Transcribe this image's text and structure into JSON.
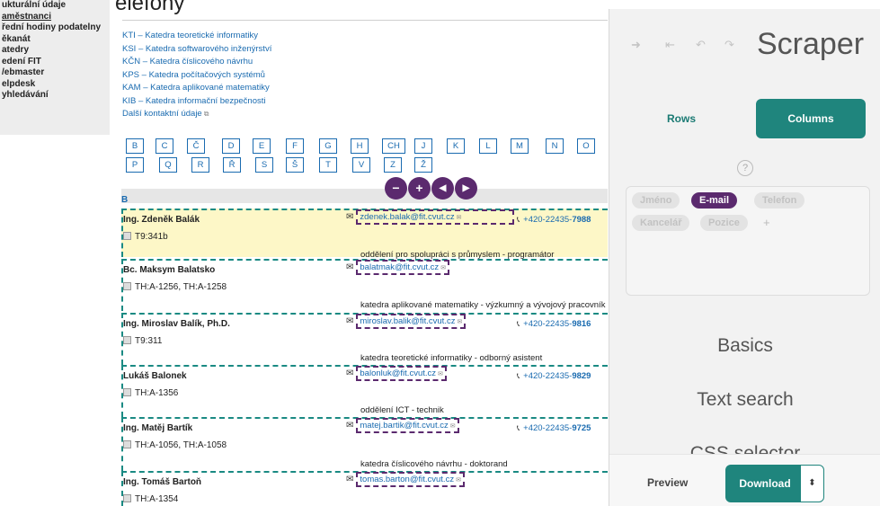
{
  "nav": {
    "items": [
      {
        "label": "ukturální údaje",
        "active": false
      },
      {
        "label": "aměstnanci",
        "active": true
      },
      {
        "label": "řední hodiny podatelny",
        "active": false
      },
      {
        "label": "ěkanát",
        "active": false
      },
      {
        "label": "atedry",
        "active": false
      },
      {
        "label": "edení FIT",
        "active": false
      },
      {
        "label": "/ebmaster",
        "active": false
      },
      {
        "label": "elpdesk",
        "active": false
      },
      {
        "label": "yhledávání",
        "active": false
      }
    ]
  },
  "page": {
    "title": "elefony"
  },
  "departments": [
    "KTI – Katedra teoretické informatiky",
    "KSI – Katedra softwarového inženýrství",
    "KČN – Katedra číslicového návrhu",
    "KPS – Katedra počítačových systémů",
    "KAM – Katedra aplikované matematiky",
    "KIB – Katedra informační bezpečnosti",
    "Další kontaktní údaje"
  ],
  "letters": {
    "row1": [
      "B",
      "C",
      "Č",
      "D",
      "E",
      "F",
      "G",
      "H",
      "CH",
      "J",
      "K",
      "L",
      "M",
      "N",
      "O"
    ],
    "row2": [
      "P",
      "Q",
      "R",
      "Ř",
      "S",
      "Š",
      "T",
      "V",
      "Z",
      "Ž"
    ]
  },
  "float_controls": {
    "minus": "−",
    "plus": "+",
    "left": "◀",
    "right": "▶"
  },
  "group_letter": "B",
  "people": [
    {
      "name": "Ing. Zdeněk Balák",
      "email": "zdenek.balak@fit.cvut.cz",
      "phone_prefix": "+420-22435-",
      "phone_ext": "7988",
      "room": "T9:341b",
      "role": "oddělení pro spolupráci s průmyslem - programátor",
      "highlight": true
    },
    {
      "name": "Bc. Maksym Balatsko",
      "email": "balatmak@fit.cvut.cz",
      "phone_prefix": "",
      "phone_ext": "",
      "room": "TH:A-1256, TH:A-1258",
      "role": "katedra aplikované matematiky - výzkumný a vývojový pracovník",
      "highlight": false
    },
    {
      "name": "Ing. Miroslav Balík, Ph.D.",
      "email": "miroslav.balik@fit.cvut.cz",
      "phone_prefix": "+420-22435-",
      "phone_ext": "9816",
      "room": "T9:311",
      "role": "katedra teoretické informatiky - odborný asistent",
      "highlight": false
    },
    {
      "name": "Lukáš Balonek",
      "email": "balonluk@fit.cvut.cz",
      "phone_prefix": "+420-22435-",
      "phone_ext": "9829",
      "room": "TH:A-1356",
      "role": "oddělení ICT - technik",
      "highlight": false
    },
    {
      "name": "Ing. Matěj Bartík",
      "email": "matej.bartik@fit.cvut.cz",
      "phone_prefix": "+420-22435-",
      "phone_ext": "9725",
      "room": "TH:A-1056, TH:A-1058",
      "role": "katedra číslicového návrhu - doktorand",
      "highlight": false
    },
    {
      "name": "Ing. Tomáš Bartoň",
      "email": "tomas.barton@fit.cvut.cz",
      "phone_prefix": "",
      "phone_ext": "",
      "room": "TH:A-1354",
      "role": "",
      "highlight": false
    }
  ],
  "scraper": {
    "title": "Scraper",
    "toolbar": {
      "forward": "➜",
      "skip": "⇤",
      "undo": "↶",
      "redo": "↷"
    },
    "tabs": {
      "rows": "Rows",
      "columns": "Columns"
    },
    "help": "?",
    "columns": [
      {
        "label": "Jméno",
        "active": false
      },
      {
        "label": "E-mail",
        "active": true
      },
      {
        "label": "Telefon",
        "active": false
      },
      {
        "label": "Kancelář",
        "active": false
      },
      {
        "label": "Pozice",
        "active": false
      }
    ],
    "add_column": "+",
    "sections": [
      "Basics",
      "Text search",
      "CSS selector"
    ],
    "preview": "Preview",
    "download": "Download",
    "download_toggle": "⬍"
  },
  "colors": {
    "accent": "#1f857d",
    "selection": "#5b2a6e",
    "link": "#1a6bb0",
    "highlight": "#fdf7c7"
  }
}
